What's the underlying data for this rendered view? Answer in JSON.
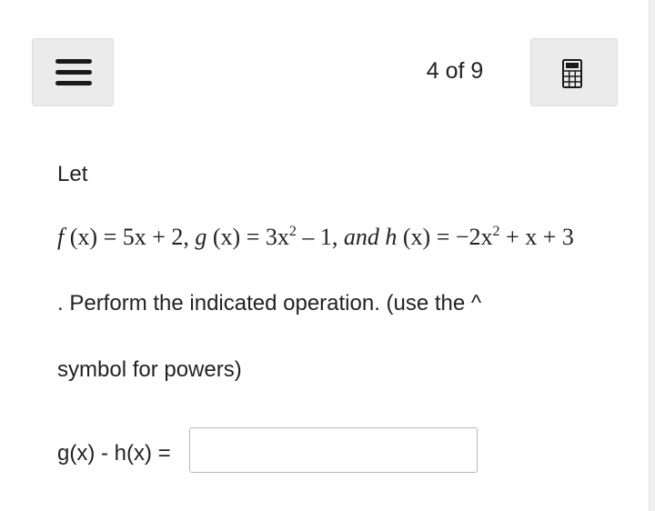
{
  "header": {
    "menu_icon": "hamburger-menu-icon",
    "progress_text": "4 of 9",
    "calculator_icon": "calculator-icon"
  },
  "question": {
    "intro": "Let",
    "definitions": {
      "f_name": "f",
      "f_arg": "(x)",
      "f_rhs": "= 5x + 2,",
      "g_name": "g",
      "g_arg": "(x)",
      "g_rhs_main": "= 3x",
      "g_exp": "2",
      "g_rhs_tail": "– 1,",
      "conjunction": "and",
      "h_name": "h",
      "h_arg": "(x)",
      "h_rhs_main": "= −2x",
      "h_exp": "2",
      "h_rhs_tail": "+ x + 3"
    },
    "instruction_line1": ". Perform the indicated operation. (use the ^",
    "instruction_line2": "symbol for powers)"
  },
  "answer": {
    "label": "g(x) - h(x) =",
    "value": "",
    "placeholder": ""
  }
}
